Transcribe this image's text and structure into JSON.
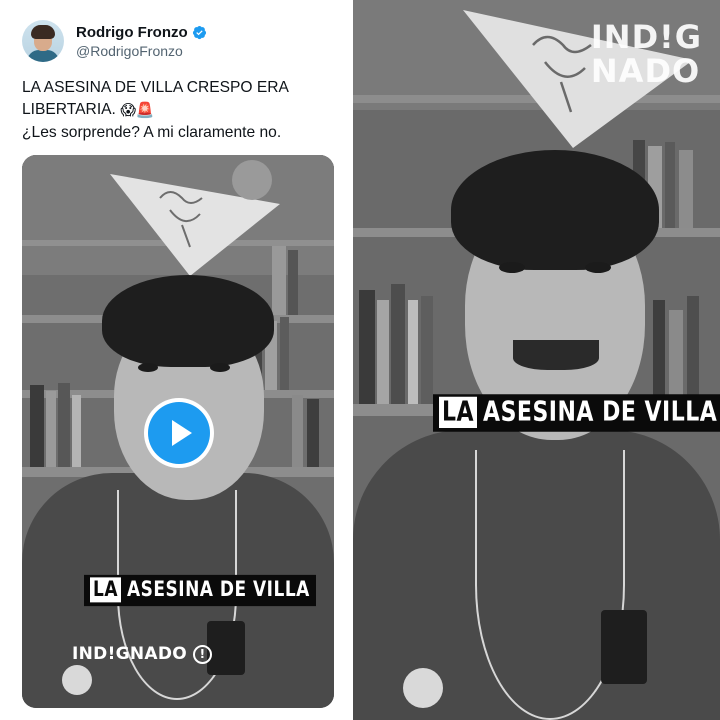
{
  "tweet": {
    "author_name": "Rodrigo Fronzo",
    "author_handle": "@RodrigoFronzo",
    "text_line1": "LA ASESINA DE VILLA CRESPO ERA",
    "text_line2": "LIBERTARIA.",
    "text_line2_emojis": "😱🚨",
    "text_line3": "¿Les sorprende? A mi claramente no."
  },
  "video_left": {
    "caption_first_word": "LA",
    "caption_rest": "ASESINA DE VILLA",
    "brand_label": "IND!GNADO",
    "brand_badge": "!"
  },
  "video_right": {
    "caption_first_word": "LA",
    "caption_rest": "ASESINA DE VILLA",
    "watermark_line1": "IND!G",
    "watermark_line2": "NADO"
  },
  "colors": {
    "accent_blue": "#1d9bf0",
    "text_primary": "#0f1419",
    "text_secondary": "#536471"
  },
  "icons": [
    "verified-badge-icon",
    "play-icon",
    "warning-badge-icon",
    "screaming-face-emoji",
    "police-light-emoji"
  ]
}
